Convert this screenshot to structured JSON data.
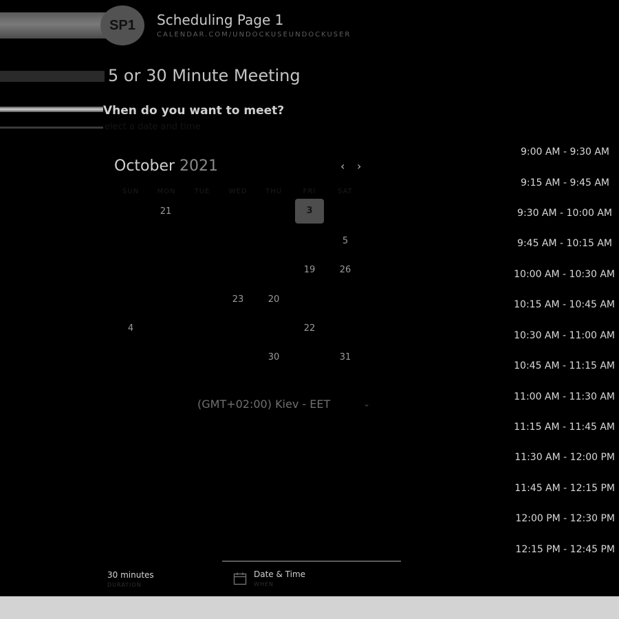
{
  "header": {
    "avatar_initials": "SP1",
    "title": "Scheduling Page 1",
    "url": "CALENDAR.COM/UNDOCKUSEUNDOCKUSER"
  },
  "meeting": {
    "title": "5 or 30 Minute Meeting",
    "question": "Vhen do you want to meet?",
    "subquestion": "elect a date and time"
  },
  "calendar": {
    "month": "October",
    "year": "2021",
    "prev_icon": "chevron-left-icon",
    "next_icon": "chevron-right-icon",
    "weekdays": [
      "SUN",
      "MON",
      "TUE",
      "WED",
      "THU",
      "FRI",
      "SAT"
    ],
    "selected_day": "3",
    "days": [
      "21",
      "3",
      "5",
      "19",
      "26",
      "23",
      "20",
      "4",
      "22",
      "30",
      "31"
    ]
  },
  "timezone": {
    "label": "(GMT+02:00) Kiev - EET",
    "icon": "chevron-down-icon"
  },
  "time_slots": [
    "9:00 AM - 9:30 AM",
    "9:15 AM - 9:45 AM",
    "9:30 AM - 10:00 AM",
    "9:45 AM - 10:15 AM",
    "10:00 AM - 10:30 AM",
    "10:15 AM - 10:45 AM",
    "10:30 AM - 11:00 AM",
    "10:45 AM - 11:15 AM",
    "11:00 AM - 11:30 AM",
    "11:15 AM - 11:45 AM",
    "11:30 AM - 12:00 PM",
    "11:45 AM - 12:15 PM",
    "12:00 PM - 12:30 PM",
    "12:15 PM - 12:45 PM"
  ],
  "footer": {
    "duration": "30 minutes",
    "duration_sub": "DURATION",
    "datetime": "Date & Time",
    "datetime_sub": "WHEN",
    "calendar_icon": "calendar-icon"
  },
  "colors": {
    "background": "#000000",
    "selected_day_bg": "#4d4d4d",
    "bottom_bar": "#d3d3d3"
  }
}
